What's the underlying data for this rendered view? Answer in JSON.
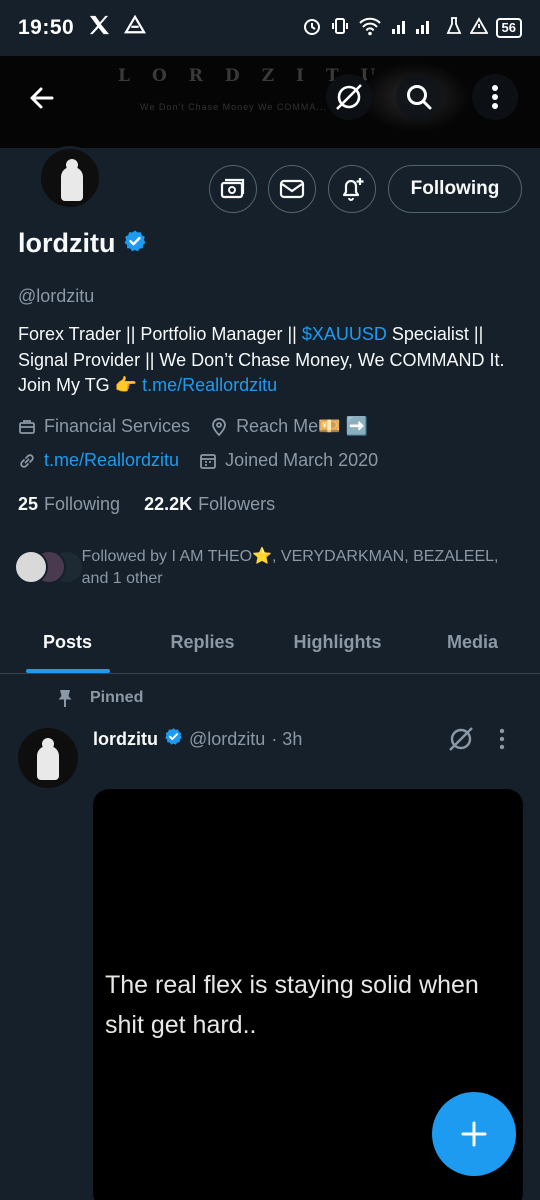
{
  "status_bar": {
    "time": "19:50",
    "battery": "56"
  },
  "profile": {
    "name": "lordzitu",
    "handle": "@lordzitu",
    "follow_label": "Following",
    "bio_part1": "Forex Trader || Portfolio Manager || ",
    "bio_cashtag": "$XAUUSD",
    "bio_part2": " Specialist || Signal Provider || We Don’t Chase Money, We COMMAND It. Join My TG 👉 ",
    "bio_link": "t.me/Reallordzitu",
    "category": "Financial Services",
    "location": "Reach Me💴 ➡️",
    "website": "t.me/Reallordzitu",
    "joined": "Joined March 2020",
    "following_count": "25",
    "following_label": "Following",
    "followers_count": "22.2K",
    "followers_label": "Followers",
    "followed_by": "Followed by I AM THEO⭐️, VERYDARKMAN, BEZALEEL, and 1 other"
  },
  "banner": {
    "text": "LORDZITU",
    "subtext": "We Don't Chase Money We COMMA..."
  },
  "tabs": [
    {
      "label": "Posts",
      "active": true
    },
    {
      "label": "Replies",
      "active": false
    },
    {
      "label": "Highlights",
      "active": false
    },
    {
      "label": "Media",
      "active": false
    }
  ],
  "post": {
    "pinned_label": "Pinned",
    "author": "lordzitu",
    "handle": "@lordzitu",
    "time": "· 3h",
    "image_text": "The real flex is staying solid when shit get hard.."
  },
  "colors": {
    "accent": "#1d9bf0",
    "background": "#15202b",
    "muted": "#8b98a5"
  }
}
